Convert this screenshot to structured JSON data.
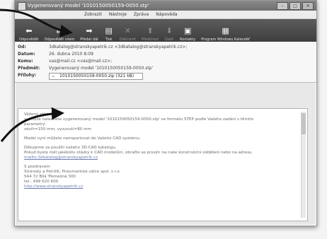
{
  "window": {
    "title": "Vygenerovaný model '1010150050159-0050.stp'",
    "menu": [
      "Zobrazit",
      "Nástroje",
      "Zpráva",
      "Nápověda"
    ]
  },
  "toolbar": [
    {
      "label": "Odpovědět",
      "icon": "reply-icon",
      "glyph": "⬅",
      "dim": false
    },
    {
      "label": "Odpovědět všem",
      "icon": "reply-all-icon",
      "glyph": "⇇",
      "dim": false
    },
    {
      "label": "Předat dál",
      "icon": "forward-icon",
      "glyph": "➡",
      "dim": false
    },
    {
      "label": "Tisk",
      "icon": "print-icon",
      "glyph": "▤",
      "dim": false
    },
    {
      "label": "Odstranit",
      "icon": "delete-icon",
      "glyph": "✕",
      "dim": true
    },
    {
      "label": "Předchozí",
      "icon": "previous-icon",
      "glyph": "⬆",
      "dim": true
    },
    {
      "label": "Další",
      "icon": "next-icon",
      "glyph": "⬇",
      "dim": true
    },
    {
      "label": "Kontakty",
      "icon": "contacts-icon",
      "glyph": "▣",
      "dim": false
    },
    {
      "label": "Program Windows Kalendář",
      "icon": "calendar-icon",
      "glyph": "▦",
      "dim": false
    }
  ],
  "headers": {
    "from_label": "Od:",
    "from_value": "3dkatalog@stranskyapetrik.cz <3dkatalog@stranskyapetrik.cz>;",
    "date_label": "Datum:",
    "date_value": "26. dubna 2010 8:09",
    "to_label": "Komu:",
    "to_value": "vas@mail.cz <vas@mail.cz>;",
    "subject_label": "Předmět:",
    "subject_value": "Vygenerovaný model '1010150050159-0050.stp'",
    "attach_label": "Přílohy:",
    "attach_value": "1010150050159-0050.zip (321 kB)"
  },
  "body": {
    "greeting": "Vážený zákazníku,",
    "line1": "v příloze naleznete vygenerovaný model '1010150050159-0050.stp' ve formátu STEP podle Vašeho zadání s těmito",
    "line2": "parametry:",
    "line3": "zdvih=150 mm; vysunutí=80 mm",
    "line4": "Model nyní můžete naimportovat do Vašeho CAD systému.",
    "line5": "Děkujeme za použití našeho 3D-CAD katalogu.",
    "line6": "Pokud byste měl jakékoliv otázky k CAD modelům, obraťte se prosím na naše konstrukční oddělení nebo na adresu",
    "link1": "mailto:3dkatalog@stranskyapetrik.cz",
    "sign1": "S pozdravem",
    "sign2": "Stránský a Petržík, Pneumatické válce spol. s r.o.",
    "sign3": "544 72 Bílá Třemešná 300",
    "sign4": "tel.: 499 620 600",
    "link2": "http://www.stranskyapetrik.cz"
  }
}
